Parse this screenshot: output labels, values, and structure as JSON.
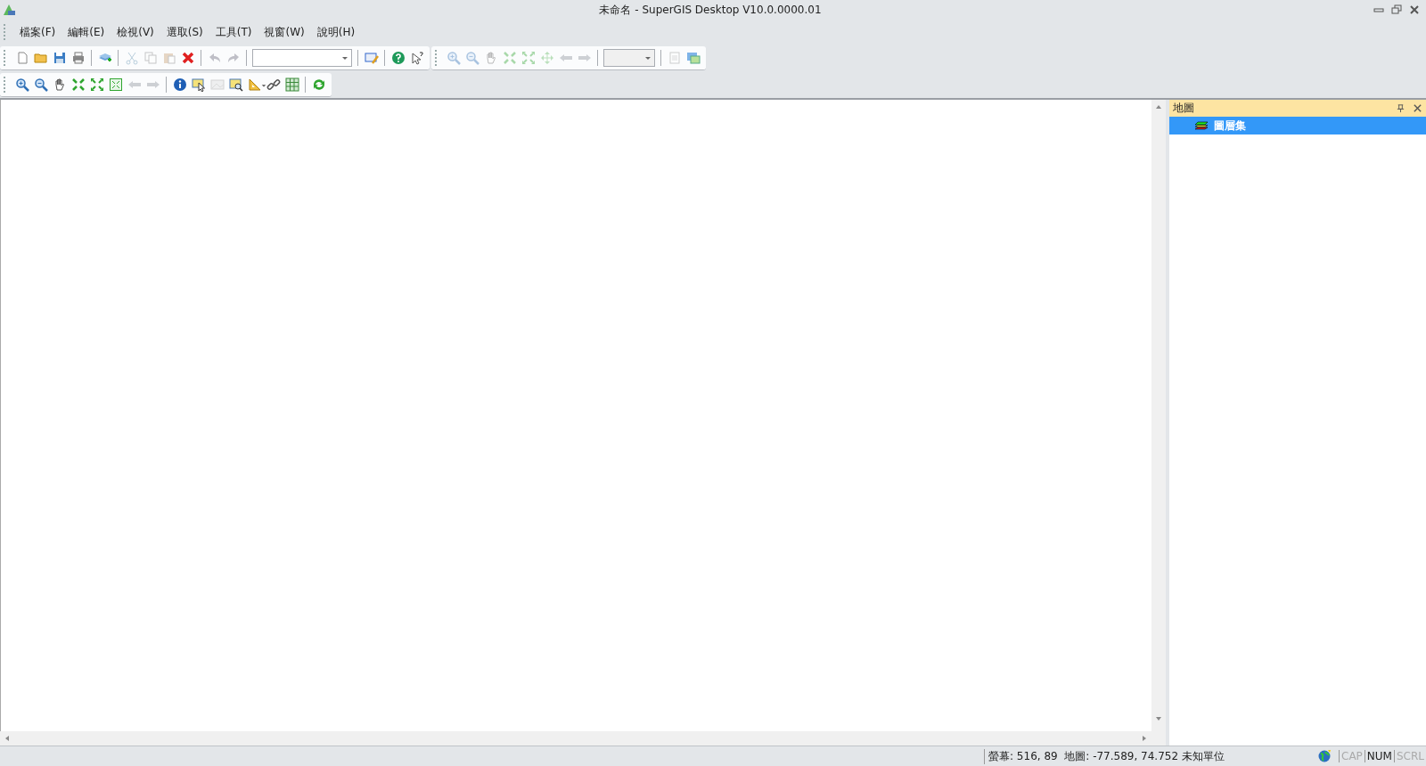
{
  "window": {
    "title": "未命名 - SuperGIS Desktop V10.0.0000.01"
  },
  "menu": [
    "檔案(F)",
    "編輯(E)",
    "檢視(V)",
    "選取(S)",
    "工具(T)",
    "視窗(W)",
    "說明(H)"
  ],
  "toolbar_rows": [
    {
      "groups": [
        {
          "items": [
            {
              "kind": "page",
              "disabled": false
            },
            {
              "kind": "folder",
              "disabled": false
            },
            {
              "kind": "save",
              "disabled": false
            },
            {
              "kind": "printer",
              "disabled": false
            },
            {
              "kind": "sep"
            },
            {
              "kind": "add-layer",
              "disabled": false
            },
            {
              "kind": "sep"
            },
            {
              "kind": "scissors",
              "disabled": true
            },
            {
              "kind": "copy",
              "disabled": true
            },
            {
              "kind": "paste",
              "disabled": true
            },
            {
              "kind": "delete",
              "disabled": false
            },
            {
              "kind": "sep"
            },
            {
              "kind": "undo",
              "disabled": true
            },
            {
              "kind": "redo",
              "disabled": true
            },
            {
              "kind": "sep"
            },
            {
              "kind": "combo",
              "disabled": false
            },
            {
              "kind": "sep"
            },
            {
              "kind": "python",
              "disabled": false
            },
            {
              "kind": "sep"
            },
            {
              "kind": "help",
              "disabled": false
            },
            {
              "kind": "pointer-help",
              "disabled": false
            }
          ]
        },
        {
          "items": [
            {
              "kind": "zoom-in",
              "disabled": true
            },
            {
              "kind": "zoom-out",
              "disabled": true
            },
            {
              "kind": "hand",
              "disabled": true
            },
            {
              "kind": "arrows-in",
              "disabled": true
            },
            {
              "kind": "arrows-out",
              "disabled": true
            },
            {
              "kind": "move",
              "disabled": true
            },
            {
              "kind": "back",
              "disabled": true
            },
            {
              "kind": "forward",
              "disabled": true
            },
            {
              "kind": "sep"
            },
            {
              "kind": "combo",
              "disabled": true
            },
            {
              "kind": "sep"
            },
            {
              "kind": "page-lines",
              "disabled": true
            },
            {
              "kind": "map-image",
              "disabled": false
            }
          ]
        }
      ]
    },
    {
      "groups": [
        {
          "items": [
            {
              "kind": "zoom-in",
              "disabled": false
            },
            {
              "kind": "zoom-out",
              "disabled": false
            },
            {
              "kind": "hand",
              "disabled": false
            },
            {
              "kind": "arrows-in",
              "disabled": false
            },
            {
              "kind": "arrows-out",
              "disabled": false
            },
            {
              "kind": "extent-box",
              "disabled": false
            },
            {
              "kind": "back",
              "disabled": true
            },
            {
              "kind": "forward",
              "disabled": true
            },
            {
              "kind": "sep"
            },
            {
              "kind": "info",
              "disabled": false
            },
            {
              "kind": "select",
              "disabled": false
            },
            {
              "kind": "image",
              "disabled": true
            },
            {
              "kind": "find-image",
              "disabled": false
            },
            {
              "kind": "ruler",
              "disabled": false
            },
            {
              "kind": "link",
              "disabled": false
            },
            {
              "kind": "grid",
              "disabled": false
            },
            {
              "kind": "sep"
            },
            {
              "kind": "refresh",
              "disabled": false
            }
          ]
        }
      ]
    }
  ],
  "panel": {
    "title": "地圖",
    "tree": [
      {
        "label": "圖層集",
        "selected": true
      }
    ]
  },
  "status_bar": {
    "coords": "螢幕: 516, 89  地圖: -77.589, 74.752 未知單位",
    "indicators": [
      {
        "label": "CAP",
        "on": false
      },
      {
        "label": "NUM",
        "on": true
      },
      {
        "label": "SCRL",
        "on": false
      }
    ]
  }
}
